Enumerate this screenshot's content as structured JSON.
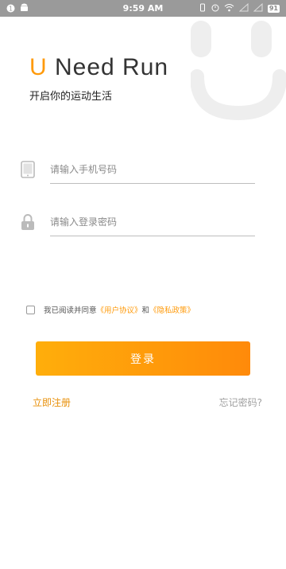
{
  "status_bar": {
    "time": "9:59 AM",
    "battery": "91"
  },
  "brand": {
    "letter": "U",
    "rest": " Need Run",
    "slogan": "开启你的运动生活"
  },
  "phone_field": {
    "placeholder": "请输入手机号码",
    "value": ""
  },
  "password_field": {
    "placeholder": "请输入登录密码",
    "value": ""
  },
  "agreement": {
    "prefix": "我已阅读并同意",
    "user_agreement": "《用户协议》",
    "and": "和",
    "privacy_policy": "《隐私政策》"
  },
  "login_button": "登录",
  "register_link": "立即注册",
  "forgot_link": "忘记密码?",
  "colors": {
    "accent": "#ff9a0a",
    "deco": "#eeeeee"
  }
}
